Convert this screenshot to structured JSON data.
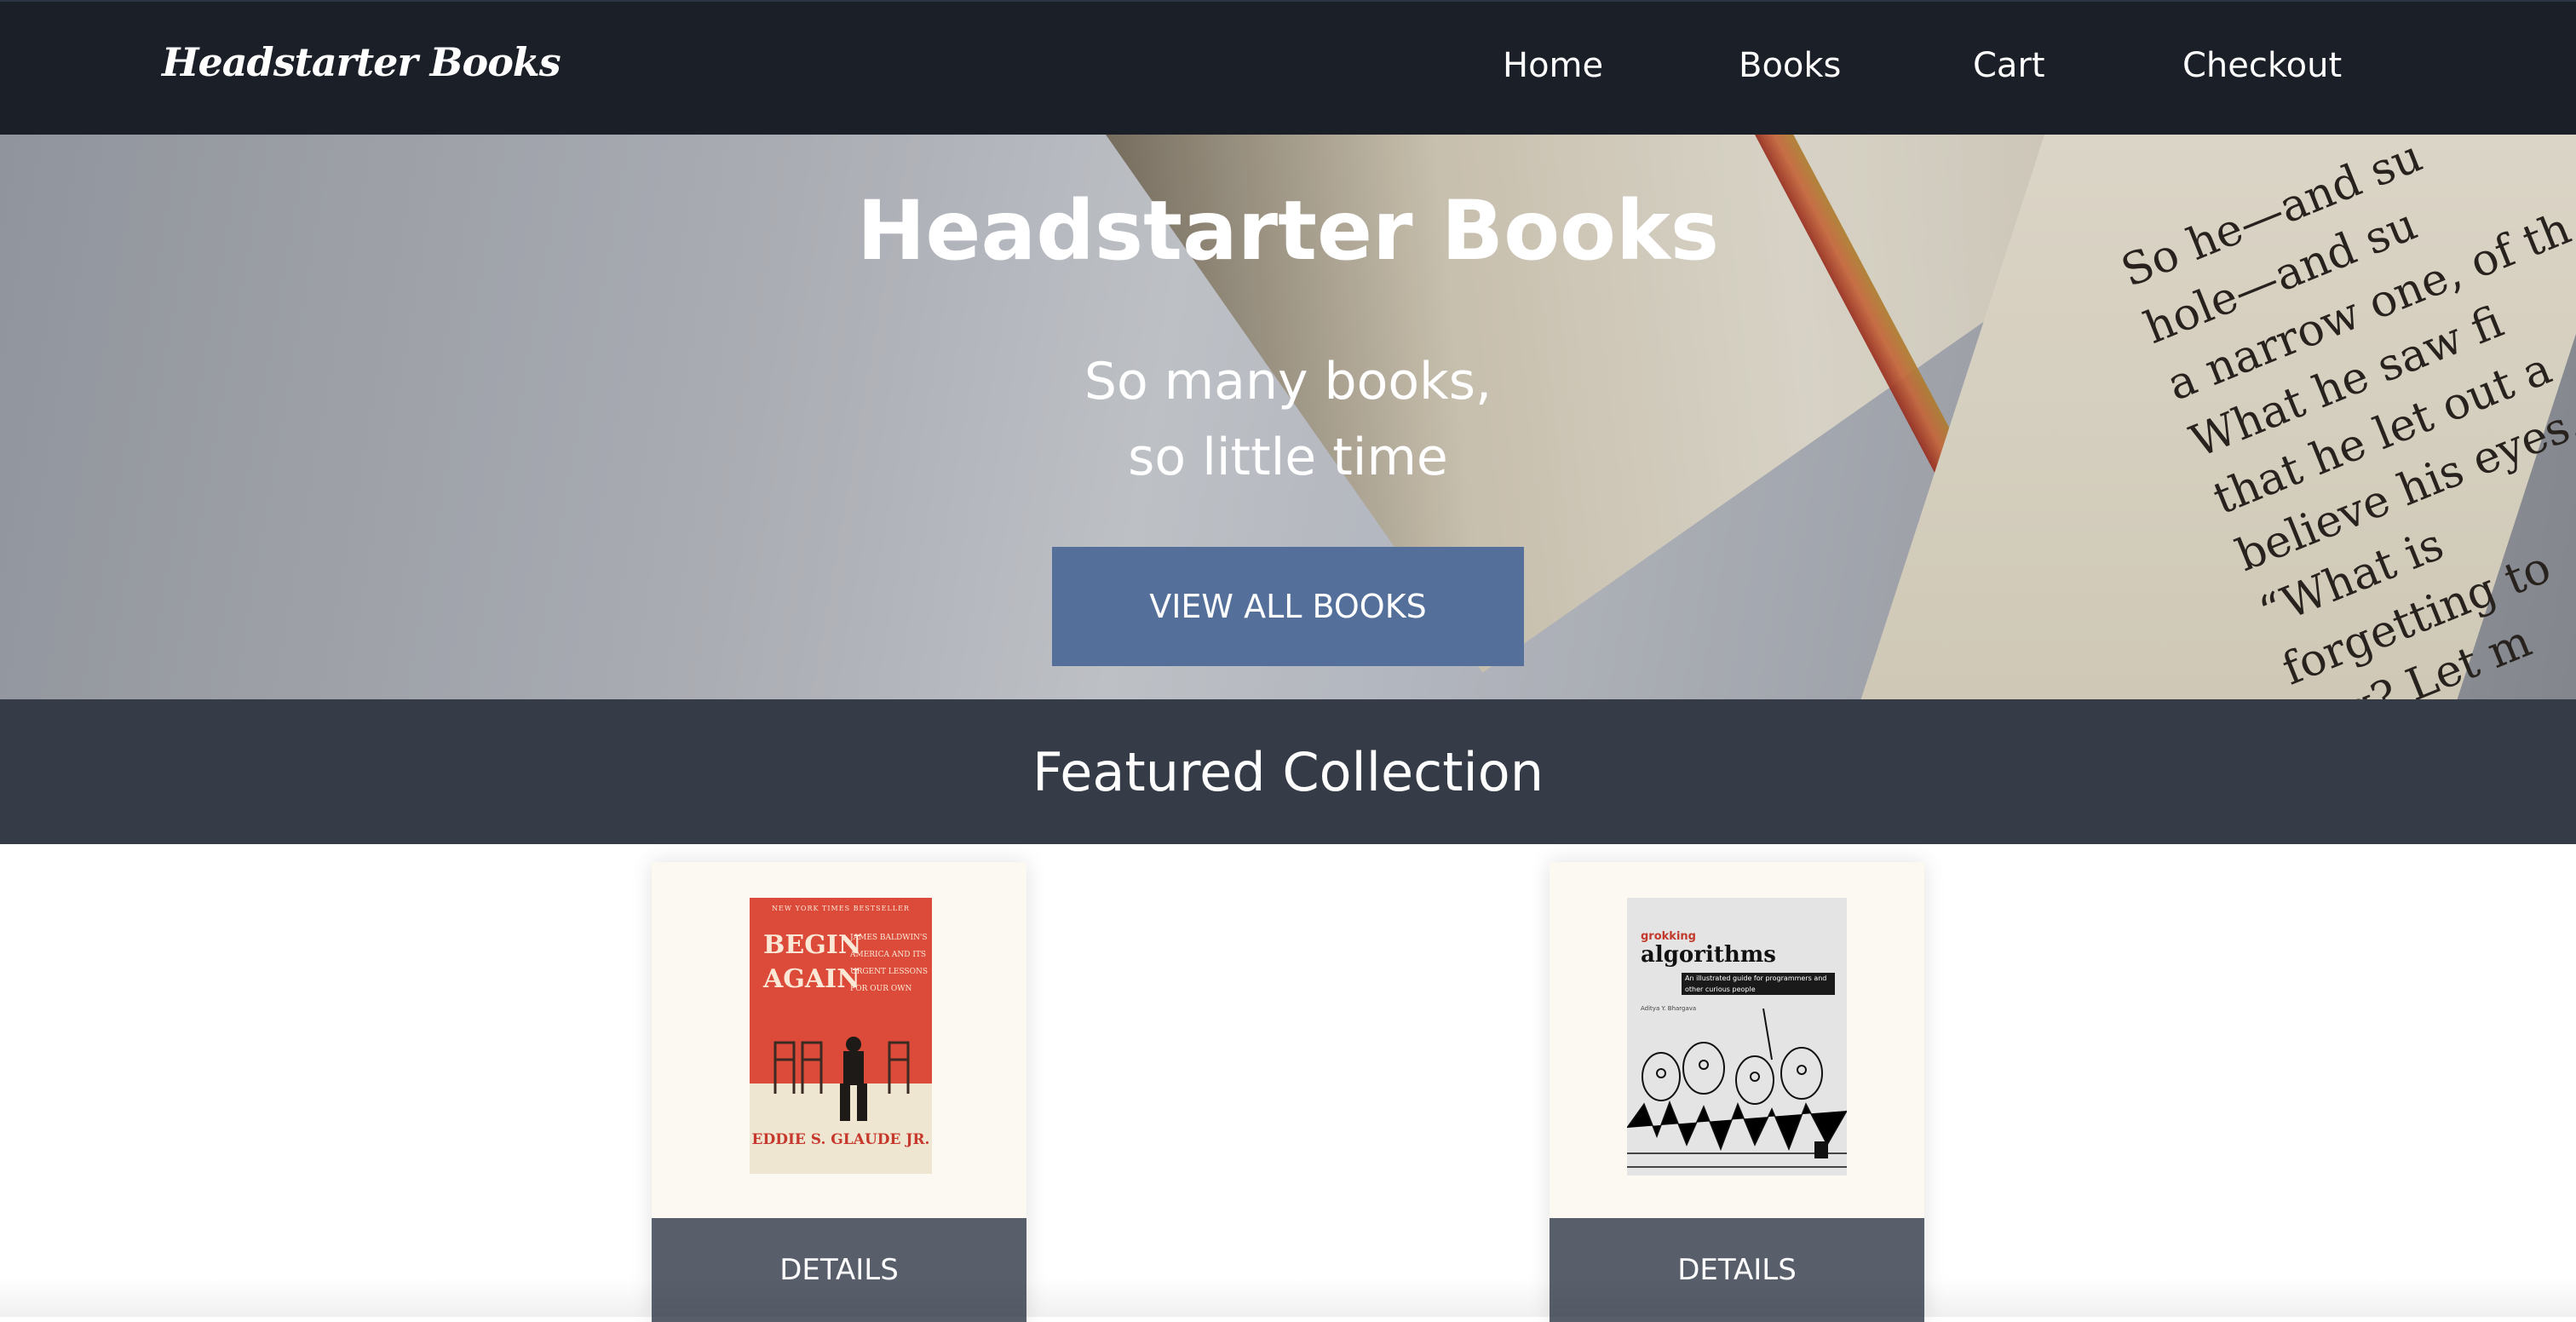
{
  "nav": {
    "brand": "Headstarter Books",
    "links": [
      "Home",
      "Books",
      "Cart",
      "Checkout"
    ]
  },
  "hero": {
    "title": "Headstarter Books",
    "subtitle_line1": "So many books,",
    "subtitle_line2": "so little time",
    "button": "VIEW ALL BOOKS",
    "background_text": "So he—and su\nhole—and su\na narrow one, of th\nWhat he saw fi\nthat he let out a\nbelieve his eyes.\n“What is\nforgetting to\ning? Let m\nShe drag"
  },
  "featured": {
    "heading": "Featured Collection"
  },
  "books": [
    {
      "details_label": "DETAILS",
      "cover": {
        "top_line": "NEW YORK TIMES BESTSELLER",
        "title_line1": "BEGIN",
        "title_line2": "AGAIN",
        "sub1": "JAMES BALDWIN'S",
        "sub2": "AMERICA AND ITS",
        "sub3": "URGENT LESSONS",
        "sub4": "FOR OUR OWN",
        "author": "EDDIE S. GLAUDE JR.",
        "color": "#dc4a3a"
      }
    },
    {
      "details_label": "DETAILS",
      "cover": {
        "top_line": "grokking",
        "title": "algorithms",
        "subtitle": "An illustrated guide for programmers and other curious people",
        "author": "Aditya Y. Bhargava",
        "color": "#e4e4e4"
      }
    }
  ]
}
